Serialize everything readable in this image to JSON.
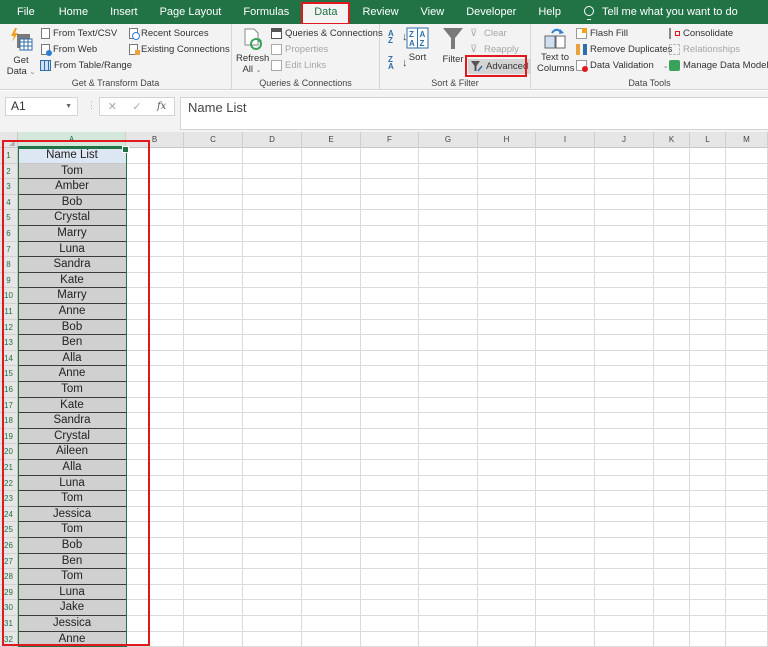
{
  "menu": {
    "tabs": [
      "File",
      "Home",
      "Insert",
      "Page Layout",
      "Formulas",
      "Data",
      "Review",
      "View",
      "Developer",
      "Help"
    ],
    "active_tab": "Data",
    "tell_me": "Tell me what you want to do"
  },
  "ribbon": {
    "get_transform": {
      "label": "Get & Transform Data",
      "get_data_line1": "Get",
      "get_data_line2": "Data",
      "from_text_csv": "From Text/CSV",
      "from_web": "From Web",
      "from_table_range": "From Table/Range",
      "recent_sources": "Recent Sources",
      "existing_connections": "Existing Connections"
    },
    "queries": {
      "label": "Queries & Connections",
      "refresh_line1": "Refresh",
      "refresh_line2": "All",
      "queries_connections": "Queries & Connections",
      "properties": "Properties",
      "edit_links": "Edit Links"
    },
    "sort_filter": {
      "label": "Sort & Filter",
      "sort": "Sort",
      "filter": "Filter",
      "clear": "Clear",
      "reapply": "Reapply",
      "advanced": "Advanced"
    },
    "data_tools": {
      "label": "Data Tools",
      "text_to_columns_line1": "Text to",
      "text_to_columns_line2": "Columns",
      "flash_fill": "Flash Fill",
      "remove_duplicates": "Remove Duplicates",
      "data_validation": "Data Validation",
      "consolidate": "Consolidate",
      "relationships": "Relationships",
      "manage_data_model": "Manage Data Model"
    }
  },
  "formula_bar": {
    "name_box": "A1",
    "cancel": "✕",
    "enter": "✓",
    "fx": "fx",
    "content": "Name List"
  },
  "sheet": {
    "columns": [
      "A",
      "B",
      "C",
      "D",
      "E",
      "F",
      "G",
      "H",
      "I",
      "J",
      "K",
      "L",
      "M"
    ],
    "selected_cell": "A1",
    "column_a": [
      "Name List",
      "Tom",
      "Amber",
      "Bob",
      "Crystal",
      "Marry",
      "Luna",
      "Sandra",
      "Kate",
      "Marry",
      "Anne",
      "Bob",
      "Ben",
      "Alla",
      "Anne",
      "Tom",
      "Kate",
      "Sandra",
      "Crystal",
      "Aileen",
      "Alla",
      "Luna",
      "Tom",
      "Jessica",
      "Tom",
      "Bob",
      "Ben",
      "Tom",
      "Luna",
      "Jake",
      "Jessica",
      "Anne"
    ],
    "row_numbers": [
      "1",
      "2",
      "3",
      "4",
      "5",
      "6",
      "7",
      "8",
      "9",
      "10",
      "11",
      "12",
      "13",
      "14",
      "15",
      "16",
      "17",
      "18",
      "19",
      "20",
      "21",
      "22",
      "23",
      "24",
      "25",
      "26",
      "27",
      "28",
      "29",
      "30",
      "31",
      "32"
    ]
  },
  "colors": {
    "brand_green": "#217346",
    "highlight_red": "#e0191f",
    "cell_fill": "#d0d0d0",
    "header_fill": "#dde6f3"
  }
}
